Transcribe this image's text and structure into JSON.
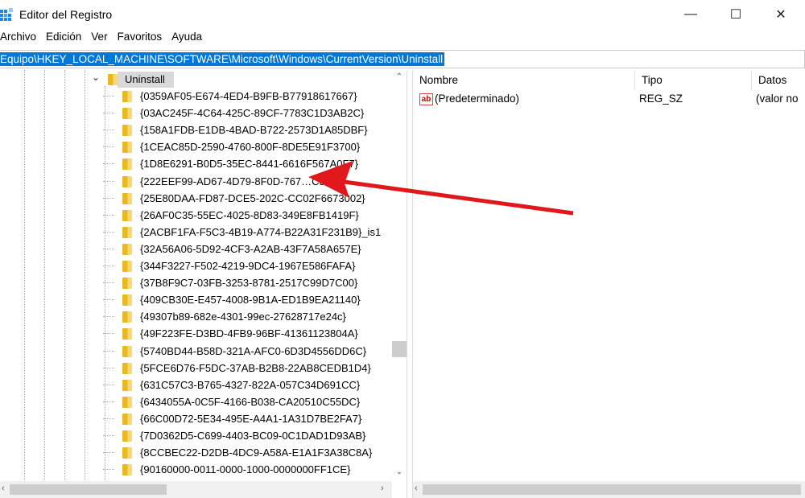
{
  "window": {
    "title": "Editor del Registro",
    "minimize": "—",
    "maximize": "☐",
    "close": "✕"
  },
  "menu": [
    "Archivo",
    "Edición",
    "Ver",
    "Favoritos",
    "Ayuda"
  ],
  "address": "Equipo\\HKEY_LOCAL_MACHINE\\SOFTWARE\\Microsoft\\Windows\\CurrentVersion\\Uninstall",
  "tree": {
    "selected": "Uninstall",
    "children": [
      "{0359AF05-E674-4ED4-B9FB-B77918617667}",
      "{03AC245F-4C64-425C-89CF-7783C1D3AB2C}",
      "{158A1FDB-E1DB-4BAD-B722-2573D1A85DBF}",
      "{1CEAC85D-2590-4760-800F-8DE5E91F3700}",
      "{1D8E6291-B0D5-35EC-8441-6616F567A0F7}",
      "{222EEF99-AD67-4D79-8F0D-767…C53E}",
      "{25E80DAA-FD87-DCE5-202C-CC02F6673002}",
      "{26AF0C35-55EC-4025-8D83-349E8FB1419F}",
      "{2ACBF1FA-F5C3-4B19-A774-B22A31F231B9}_is1",
      "{32A56A06-5D92-4CF3-A2AB-43F7A58A657E}",
      "{344F3227-F502-4219-9DC4-1967E586FAFA}",
      "{37B8F9C7-03FB-3253-8781-2517C99D7C00}",
      "{409CB30E-E457-4008-9B1A-ED1B9EA21140}",
      "{49307b89-682e-4301-99ec-27628717e24c}",
      "{49F223FE-D3BD-4FB9-96BF-41361123804A}",
      "{5740BD44-B58D-321A-AFC0-6D3D4556DD6C}",
      "{5FCE6D76-F5DC-37AB-B2B8-22AB8CEDB1D4}",
      "{631C57C3-B765-4327-822A-057C34D691CC}",
      "{6434055A-0C5F-4166-B038-CA20510C55DC}",
      "{66C00D72-5E34-495E-A4A1-1A31D7BE2FA7}",
      "{7D0362D5-C699-4403-BC09-0C1DAD1D93AB}",
      "{8CCBEC22-D2DB-4DC9-A58A-E1A1F3A38C8A}",
      "{90160000-0011-0000-1000-0000000FF1CE}"
    ]
  },
  "values": {
    "headers": [
      "Nombre",
      "Tipo",
      "Datos"
    ],
    "rows": [
      {
        "name": "(Predeterminado)",
        "type": "REG_SZ",
        "data": "(valor no"
      }
    ]
  },
  "colors": {
    "selection": "#0078d7",
    "annotation_arrow": "#e0181b"
  }
}
